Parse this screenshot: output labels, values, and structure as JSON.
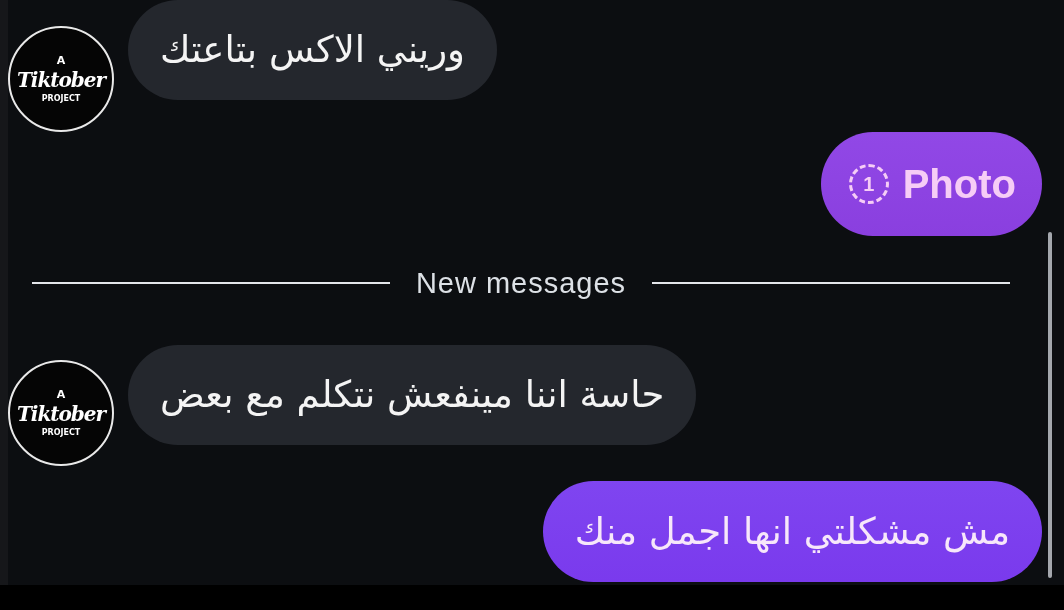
{
  "messages": [
    {
      "kind": "incoming",
      "text": "وريني الاكس بتاعتك",
      "avatar": {
        "line_1": "A",
        "line_2": "Tiktober",
        "line_3": "PROJECT"
      }
    },
    {
      "kind": "photo",
      "count": "1",
      "text": "Photo"
    },
    {
      "kind": "divider",
      "text": "New messages"
    },
    {
      "kind": "incoming",
      "text": "حاسة اننا مينفعش نتكلم مع بعض",
      "avatar": {
        "line_1": "A",
        "line_2": "Tiktober",
        "line_3": "PROJECT"
      }
    },
    {
      "kind": "outgoing",
      "text": "مش مشكلتي انها اجمل منك"
    }
  ]
}
